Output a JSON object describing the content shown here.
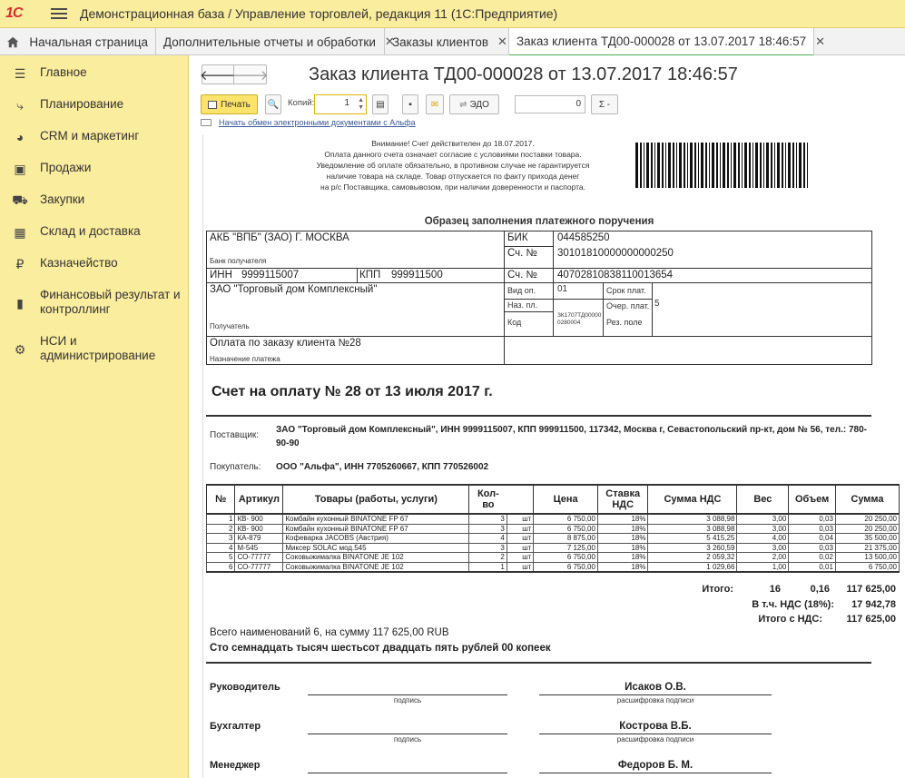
{
  "app": {
    "logo": "1С",
    "title": "Демонстрационная база / Управление торговлей, редакция 11  (1С:Предприятие)"
  },
  "tabs": [
    {
      "label": "Начальная страница"
    },
    {
      "label": "Дополнительные отчеты и обработки"
    },
    {
      "label": "Заказы клиентов"
    },
    {
      "label": "Заказ клиента ТД00-000028 от 13.07.2017 18:46:57",
      "active": true
    }
  ],
  "sidebar": {
    "items": [
      {
        "label": "Главное",
        "icon": "list-icon"
      },
      {
        "label": "Планирование",
        "icon": "planning-icon"
      },
      {
        "label": "CRM и маркетинг",
        "icon": "pie-chart-icon"
      },
      {
        "label": "Продажи",
        "icon": "bag-icon"
      },
      {
        "label": "Закупки",
        "icon": "cart-icon"
      },
      {
        "label": "Склад и доставка",
        "icon": "warehouse-icon"
      },
      {
        "label": "Казначейство",
        "icon": "ruble-icon"
      },
      {
        "label": "Финансовый результат и контроллинг",
        "icon": "bar-chart-icon"
      },
      {
        "label": "НСИ и администрирование",
        "icon": "gear-icon"
      }
    ]
  },
  "document": {
    "title": "Заказ клиента ТД00-000028 от 13.07.2017 18:46:57"
  },
  "toolbar": {
    "print_label": "Печать",
    "copies_label": "Копий:",
    "copies_value": "1",
    "edo_label": "ЭДО",
    "sum_value": "0",
    "sigma_label": "Σ -",
    "edo_link": "Начать обмен электронными документами с Альфа"
  },
  "print": {
    "notice": [
      "Внимание! Счет действителен до 18.07.2017.",
      "Оплата данного счета означает согласие с условиями поставки товара.",
      "Уведомление об оплате обязательно, в противном случае не гарантируется",
      "наличие товара на складе. Товар отпускается по факту прихода денег",
      "на р/с Поставщика, самовывозом, при наличии доверенности и паспорта."
    ],
    "payment_title": "Образец заполнения платежного поручения",
    "bank_name": "АКБ \"ВПБ\" (ЗАО) Г. МОСКВА",
    "bank_caption": "Банк получателя",
    "bik_label": "БИК",
    "bik_value": "044585250",
    "corr_label": "Сч. №",
    "corr_value": "30101810000000000250",
    "inn_label": "ИНН",
    "inn_value": "9999115007",
    "kpp_label": "КПП",
    "kpp_value": "999911500",
    "acc_label": "Сч. №",
    "acc_value": "40702810838110013654",
    "recipient": "ЗАО \"Торговый дом Комплексный\"",
    "recipient_caption": "Получатель",
    "vid_label": "Вид оп.",
    "vid_value": "01",
    "naz_label": "Наз. пл.",
    "kod_label": "Код",
    "kod_value": "ЗК1707ТД000000280004",
    "srok_label": "Срок плат.",
    "ocher_label": "Очер. плат.",
    "ocher_value": "5",
    "rez_label": "Рез. поле",
    "purpose": "Оплата по заказу клиента №28",
    "purpose_caption": "Назначение платежа",
    "invoice_title": "Счет на оплату № 28 от 13 июля 2017 г.",
    "supplier_label": "Поставщик:",
    "supplier": "ЗАО \"Торговый дом Комплексный\", ИНН 9999115007, КПП 999911500, 117342, Москва г, Севастопольский пр-кт, дом № 56, тел.: 780-90-90",
    "buyer_label": "Покупатель:",
    "buyer": "ООО \"Альфа\", ИНН 7705260667, КПП 770526002",
    "columns": [
      "№",
      "Артикул",
      "Товары (работы, услуги)",
      "Кол-во",
      "",
      "Цена",
      "Ставка НДС",
      "Сумма НДС",
      "Вес",
      "Объем",
      "Сумма"
    ],
    "rows": [
      [
        "1",
        "КВ- 900",
        "Комбайн кухонный BINATONE FP 67",
        "3",
        "шт",
        "6 750,00",
        "18%",
        "3 088,98",
        "3,00",
        "0,03",
        "20 250,00"
      ],
      [
        "2",
        "КВ- 900",
        "Комбайн кухонный BINATONE FP 67",
        "3",
        "шт",
        "6 750,00",
        "18%",
        "3 088,98",
        "3,00",
        "0,03",
        "20 250,00"
      ],
      [
        "3",
        "КА-879",
        "Кофеварка JACOBS (Австрия)",
        "4",
        "шт",
        "8 875,00",
        "18%",
        "5 415,25",
        "4,00",
        "0,04",
        "35 500,00"
      ],
      [
        "4",
        "М-545",
        "Миксер SOLAC мод.545",
        "3",
        "шт",
        "7 125,00",
        "18%",
        "3 260,59",
        "3,00",
        "0,03",
        "21 375,00"
      ],
      [
        "5",
        "СО-77777",
        "Соковыжималка  BINATONE JE 102",
        "2",
        "шт",
        "6 750,00",
        "18%",
        "2 059,32",
        "2,00",
        "0,02",
        "13 500,00"
      ],
      [
        "6",
        "СО-77777",
        "Соковыжималка  BINATONE JE 102",
        "1",
        "шт",
        "6 750,00",
        "18%",
        "1 029,66",
        "1,00",
        "0,01",
        "6 750,00"
      ]
    ],
    "total_label": "Итого:",
    "total_weight": "16",
    "total_volume": "0,16",
    "total_sum": "117 625,00",
    "vat_label": "В т.ч. НДС (18%):",
    "vat_value": "17 942,78",
    "total_vat_label": "Итого с НДС:",
    "total_vat_value": "117 625,00",
    "summary_count": "Всего наименований 6, на сумму 117 625,00 RUB",
    "summary_words": "Сто семнадцать тысяч шестьсот двадцать пять рублей 00 копеек",
    "signatures": [
      {
        "role": "Руководитель",
        "name": "Исаков О.В."
      },
      {
        "role": "Бухгалтер",
        "name": "Кострова В.Б."
      },
      {
        "role": "Менеджер",
        "name": "Федоров Б. М."
      }
    ],
    "sign_caption": "подпись",
    "decode_caption": "расшифровка подписи"
  }
}
